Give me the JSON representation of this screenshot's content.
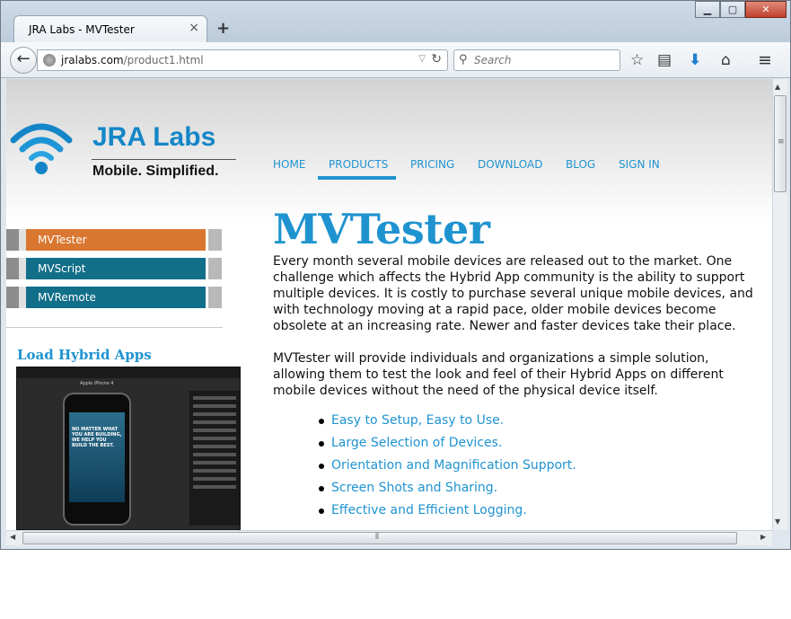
{
  "browser": {
    "tab_title": "JRA Labs - MVTester",
    "tab_close": "×",
    "new_tab": "+",
    "window_controls": {
      "minimize": "▁",
      "maximize": "▢",
      "close": "✕"
    },
    "url_host": "jralabs.com",
    "url_path": "/product1.html",
    "search_placeholder": "Search",
    "icons": [
      "back-arrow-icon",
      "globe-icon",
      "reload-icon",
      "search-icon",
      "bookmark-star-icon",
      "reading-list-icon",
      "download-arrow-icon",
      "home-icon",
      "menu-icon"
    ]
  },
  "logo": {
    "name": "JRA Labs",
    "tagline": "Mobile. Simplified.",
    "icon_color": "#1486c7"
  },
  "nav": {
    "items": [
      "HOME",
      "PRODUCTS",
      "PRICING",
      "DOWNLOAD",
      "BLOG",
      "SIGN IN"
    ],
    "active": "PRODUCTS"
  },
  "sidebar": {
    "items": [
      {
        "label": "MVTester",
        "color": "#d9762f"
      },
      {
        "label": "MVScript",
        "color": "#126f8a"
      },
      {
        "label": "MVRemote",
        "color": "#126f8a"
      }
    ],
    "section_title": "Load Hybrid Apps",
    "screenshot_header": "Apple iPhone 4",
    "phone_text": "NO MATTER WHAT YOU ARE BUILDING, WE HELP YOU BUILD THE BEST."
  },
  "main": {
    "title": "MVTester",
    "paragraph1": "Every month several mobile devices are released out to the market. One challenge which affects the Hybrid App community is the ability to support multiple devices. It is costly to purchase several unique mobile devices, and with technology moving at a rapid pace, older mobile devices become obsolete at an increasing rate. Newer and faster devices take their place.",
    "paragraph2": "MVTester will provide individuals and organizations a simple solution, allowing them to test the look and feel of their Hybrid Apps on different mobile devices without the need of the physical device itself.",
    "features": [
      "Easy to Setup, Easy to Use.",
      "Large Selection of Devices.",
      "Orientation and Magnification Support.",
      "Screen Shots and Sharing.",
      "Effective and Efficient Logging."
    ]
  },
  "colors": {
    "accent": "#1f93d0",
    "sidebar_active": "#d9762f",
    "sidebar_default": "#126f8a"
  }
}
